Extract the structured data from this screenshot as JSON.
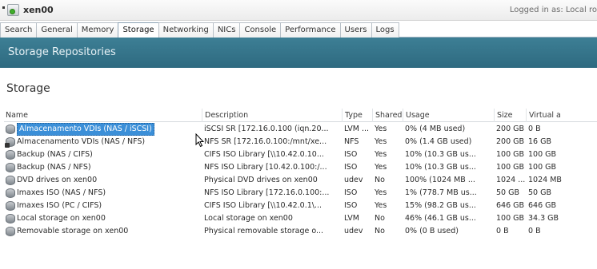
{
  "window": {
    "server_name": "xen00",
    "login_status": "Logged in as: Local ro"
  },
  "tabs": [
    {
      "label": "Search",
      "active": false
    },
    {
      "label": "General",
      "active": false
    },
    {
      "label": "Memory",
      "active": false
    },
    {
      "label": "Storage",
      "active": true
    },
    {
      "label": "Networking",
      "active": false
    },
    {
      "label": "NICs",
      "active": false
    },
    {
      "label": "Console",
      "active": false
    },
    {
      "label": "Performance",
      "active": false
    },
    {
      "label": "Users",
      "active": false
    },
    {
      "label": "Logs",
      "active": false
    }
  ],
  "banner": {
    "title": "Storage Repositories"
  },
  "section": {
    "title": "Storage"
  },
  "grid": {
    "columns": [
      "Name",
      "Description",
      "Type",
      "Shared",
      "Usage",
      "Size",
      "Virtual a"
    ],
    "rows": [
      {
        "name": "Almacenamento VDIs (NAS / iSCSI)",
        "description": "iSCSI SR [172.16.0.100 (iqn.20...",
        "type": "LVM ...",
        "shared": "Yes",
        "usage": "0% (4 MB used)",
        "size": "200 GB",
        "virtual": "0 B",
        "selected": true,
        "icon": "storage-repository-icon"
      },
      {
        "name": "Almacenamento VDIs (NAS / NFS)",
        "description": "NFS SR [172.16.0.100:/mnt/xe...",
        "type": "NFS",
        "shared": "Yes",
        "usage": "0% (1.4 GB used)",
        "size": "200 GB",
        "virtual": "16 GB",
        "selected": false,
        "icon": "default-storage-repository-icon"
      },
      {
        "name": "Backup (NAS / CIFS)",
        "description": "CIFS ISO Library [\\\\10.42.0.10...",
        "type": "ISO",
        "shared": "Yes",
        "usage": "10% (10.3 GB us...",
        "size": "100 GB",
        "virtual": "100 GB",
        "selected": false,
        "icon": "storage-repository-icon"
      },
      {
        "name": "Backup (NAS / NFS)",
        "description": "NFS ISO Library [10.42.0.100:/...",
        "type": "ISO",
        "shared": "Yes",
        "usage": "10% (10.3 GB us...",
        "size": "100 GB",
        "virtual": "100 GB",
        "selected": false,
        "icon": "storage-repository-icon"
      },
      {
        "name": "DVD drives on xen00",
        "description": "Physical DVD drives on xen00",
        "type": "udev",
        "shared": "No",
        "usage": "100% (1024 MB ...",
        "size": "1024 ...",
        "virtual": "1024 MB",
        "selected": false,
        "icon": "storage-repository-icon"
      },
      {
        "name": "Imaxes ISO (NAS / NFS)",
        "description": "NFS ISO Library [172.16.0.100:...",
        "type": "ISO",
        "shared": "Yes",
        "usage": "1% (778.7 MB us...",
        "size": "50 GB",
        "virtual": "50 GB",
        "selected": false,
        "icon": "storage-repository-icon"
      },
      {
        "name": "Imaxes ISO (PC / CIFS)",
        "description": "CIFS ISO Library [\\\\10.42.0.1\\...",
        "type": "ISO",
        "shared": "Yes",
        "usage": "15% (98.2 GB us...",
        "size": "646 GB",
        "virtual": "646 GB",
        "selected": false,
        "icon": "storage-repository-icon"
      },
      {
        "name": "Local storage on xen00",
        "description": "Local storage on xen00",
        "type": "LVM",
        "shared": "No",
        "usage": "46% (46.1 GB us...",
        "size": "100 GB",
        "virtual": "34.3 GB",
        "selected": false,
        "icon": "storage-repository-icon"
      },
      {
        "name": "Removable storage on xen00",
        "description": "Physical removable storage o...",
        "type": "udev",
        "shared": "No",
        "usage": "0% (0 B used)",
        "size": "0 B",
        "virtual": "0 B",
        "selected": false,
        "icon": "storage-repository-icon"
      }
    ]
  },
  "colors": {
    "banner": "#3d7f95",
    "selection": "#3b8fd8",
    "status_dot": "#3fae2a"
  }
}
